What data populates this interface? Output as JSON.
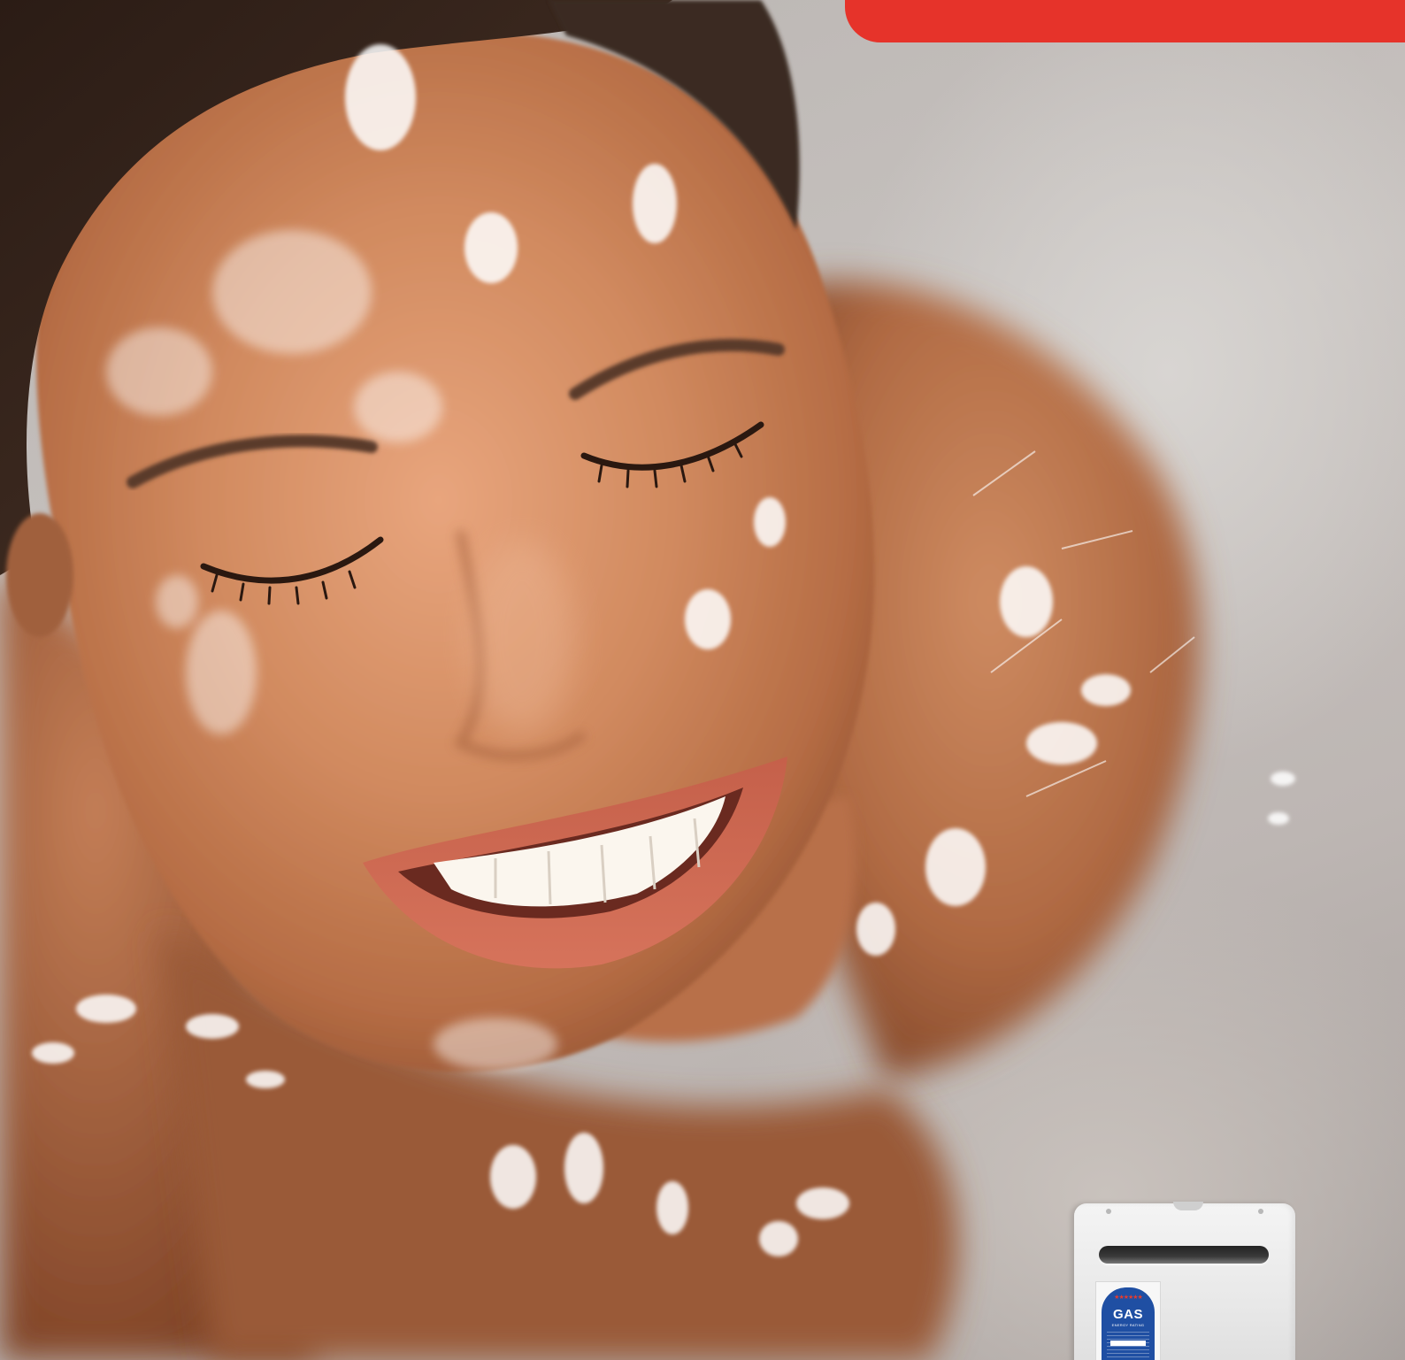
{
  "banner": {
    "color": "#e6332a"
  },
  "product": {
    "type": "water-heater",
    "gas_label": {
      "title": "GAS",
      "subtitle": "ENERGY RATING",
      "stars": "★★★★★★",
      "color": "#1f4fa3"
    }
  }
}
